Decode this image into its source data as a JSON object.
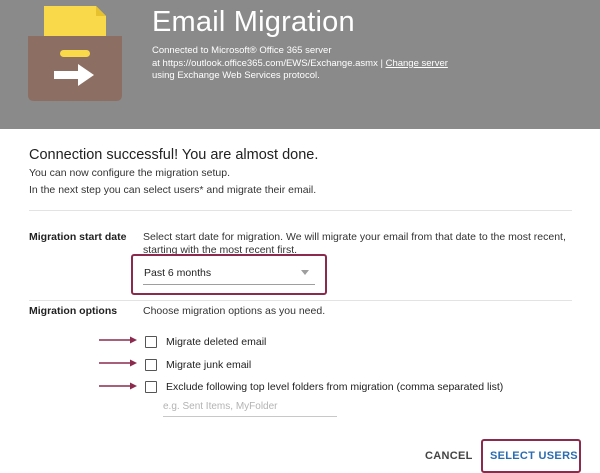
{
  "header": {
    "title": "Email Migration",
    "connection_line1": "Connected to Microsoft® Office 365 server",
    "connection_line2_prefix": "at https://outlook.office365.com/EWS/Exchange.asmx | ",
    "change_server_label": "Change server",
    "connection_line3": "using Exchange Web Services protocol.",
    "icon": "mail-archive-export-icon"
  },
  "status": {
    "success_title": "Connection successful! You are almost done.",
    "line1": "You can now configure the migration setup.",
    "line2": "In the next step you can select users* and migrate their email."
  },
  "start_date": {
    "label": "Migration start date",
    "description": "Select start date for migration. We will migrate your email from that date to the most recent, starting with the most recent first.",
    "selected": "Past 6 months"
  },
  "options": {
    "label": "Migration options",
    "description": "Choose migration options as you need.",
    "items": [
      {
        "label": "Migrate deleted email",
        "checked": false
      },
      {
        "label": "Migrate junk email",
        "checked": false
      },
      {
        "label": "Exclude following top level folders from migration (comma separated list)",
        "checked": false
      }
    ],
    "folders_placeholder": "e.g. Sent Items, MyFolder",
    "folders_value": ""
  },
  "actions": {
    "cancel_label": "CANCEL",
    "select_users_label": "SELECT USERS"
  },
  "colors": {
    "header_bg": "#8a8a8a",
    "highlight": "#8c2a4d",
    "primary": "#2b6cb0",
    "icon_box": "#8d6e63",
    "icon_file": "#f9d94a"
  }
}
